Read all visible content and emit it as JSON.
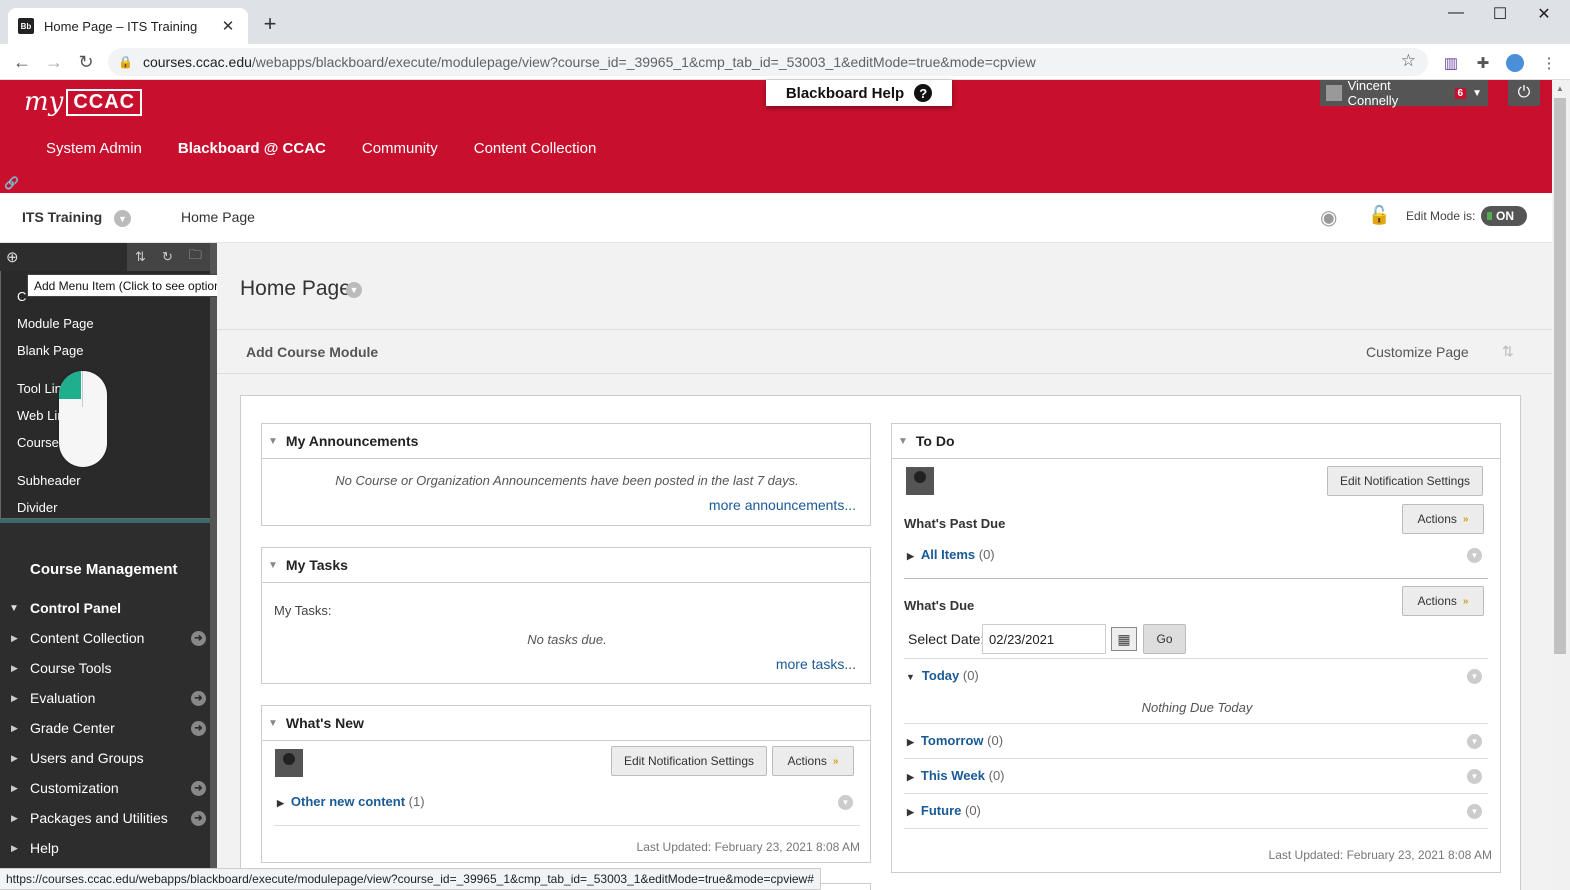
{
  "browser": {
    "tab_title": "Home Page – ITS Training",
    "favicon_text": "Bb",
    "url_host": "courses.ccac.edu",
    "url_path": "/webapps/blackboard/execute/modulepage/view?course_id=_39965_1&cmp_tab_id=_53003_1&editMode=true&mode=cpview",
    "status_url": "https://courses.ccac.edu/webapps/blackboard/execute/modulepage/view?course_id=_39965_1&cmp_tab_id=_53003_1&editMode=true&mode=cpview#"
  },
  "header": {
    "logo_my": "my",
    "logo_ccac": "CCAC",
    "help_label": "Blackboard Help",
    "user_name": "Vincent Connelly",
    "notification_count": "6",
    "nav": [
      "System Admin",
      "Blackboard @ CCAC",
      "Community",
      "Content Collection"
    ]
  },
  "breadcrumb": {
    "course": "ITS Training",
    "page": "Home Page",
    "edit_mode_label": "Edit Mode is:",
    "edit_mode_value": "ON"
  },
  "sidebar": {
    "tooltip": "Add Menu Item (Click to see options)",
    "menu_items": [
      "C",
      "Module Page",
      "Blank Page",
      "Tool Lin",
      "Web Lin",
      "Course",
      "Subheader",
      "Divider"
    ],
    "course_management": "Course Management",
    "control_panel": "Control Panel",
    "cp_items": [
      "Content Collection",
      "Course Tools",
      "Evaluation",
      "Grade Center",
      "Users and Groups",
      "Customization",
      "Packages and Utilities",
      "Help"
    ]
  },
  "main": {
    "page_title": "Home Page",
    "add_module": "Add Course Module",
    "customize": "Customize Page",
    "announcements": {
      "title": "My Announcements",
      "empty": "No Course or Organization Announcements have been posted in the last 7 days.",
      "more": "more announcements..."
    },
    "tasks": {
      "title": "My Tasks",
      "label": "My Tasks:",
      "empty": "No tasks due.",
      "more": "more tasks..."
    },
    "whats_new": {
      "title": "What's New",
      "edit_btn": "Edit Notification Settings",
      "actions_btn": "Actions",
      "other_label": "Other new content",
      "other_count": "(1)",
      "updated": "Last Updated: February 23, 2021 8:08 AM"
    },
    "todo": {
      "title": "To Do",
      "edit_btn": "Edit Notification Settings",
      "past_due": "What's Past Due",
      "actions_btn": "Actions",
      "all_items": "All Items",
      "all_count": "(0)",
      "whats_due": "What's Due",
      "select_date_label": "Select Date:",
      "date_value": "02/23/2021",
      "go_btn": "Go",
      "today": "Today",
      "today_count": "(0)",
      "nothing_due": "Nothing Due Today",
      "tomorrow": "Tomorrow",
      "tomorrow_count": "(0)",
      "this_week": "This Week",
      "this_week_count": "(0)",
      "future": "Future",
      "future_count": "(0)",
      "updated": "Last Updated: February 23, 2021 8:08 AM"
    }
  },
  "colors": {
    "brand_red": "#c8102e",
    "link_blue": "#1a5a96",
    "sidebar_dark": "#2d2d2d"
  }
}
